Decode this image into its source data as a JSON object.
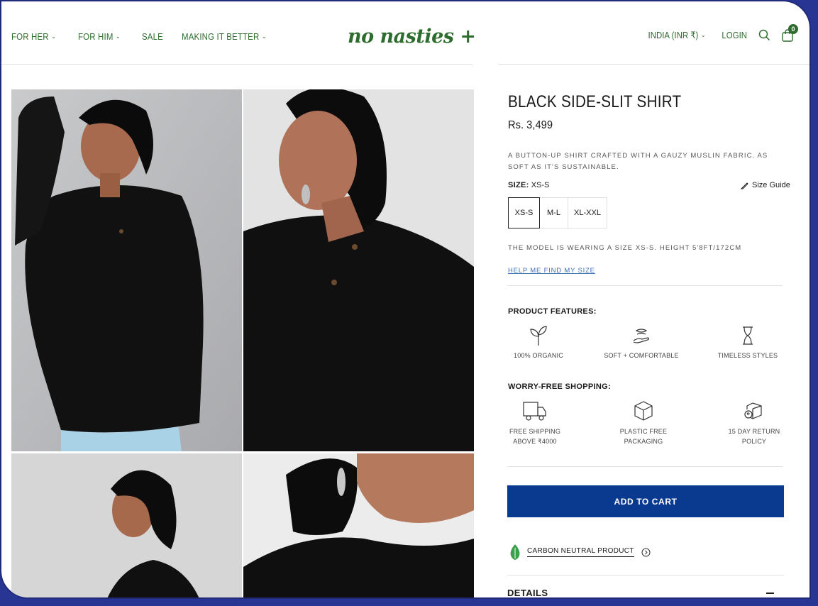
{
  "nav": {
    "items": [
      {
        "label": "FOR HER",
        "has_dropdown": true
      },
      {
        "label": "FOR HIM",
        "has_dropdown": true
      },
      {
        "label": "SALE",
        "has_dropdown": false
      },
      {
        "label": "MAKING IT BETTER",
        "has_dropdown": true
      }
    ],
    "chevron": "⌄"
  },
  "brand": {
    "logo_text": "no nasties +",
    "color": "#2e6b2e"
  },
  "header_right": {
    "currency": "INDIA (INR ₹)",
    "login": "LOGIN",
    "cart_count": "0"
  },
  "gallery": {
    "images": [
      {
        "alt": "model in black shirt, hand behind head"
      },
      {
        "alt": "close-up of model in black shirt"
      },
      {
        "alt": "model side profile"
      },
      {
        "alt": "close-up of collar and earring"
      }
    ]
  },
  "product": {
    "title": "BLACK SIDE-SLIT SHIRT",
    "price": "Rs. 3,499",
    "description": "A BUTTON-UP SHIRT CRAFTED WITH A GAUZY MUSLIN FABRIC. AS SOFT AS IT'S SUSTAINABLE.",
    "size_label": "SIZE:",
    "selected_size": "XS-S",
    "size_guide": "Size Guide",
    "sizes": [
      "XS-S",
      "M-L",
      "XL-XXL"
    ],
    "model_note": "THE MODEL IS WEARING A SIZE XS-S. HEIGHT 5'8FT/172CM",
    "help_link": "HELP ME FIND MY SIZE"
  },
  "features": {
    "title": "PRODUCT FEATURES:",
    "items": [
      {
        "icon": "sprout-icon",
        "label": "100% ORGANIC"
      },
      {
        "icon": "hand-fabric-icon",
        "label": "SOFT + COMFORTABLE"
      },
      {
        "icon": "hourglass-icon",
        "label": "TIMELESS STYLES"
      }
    ]
  },
  "shopping": {
    "title": "WORRY-FREE SHOPPING:",
    "items": [
      {
        "icon": "truck-icon",
        "line1": "FREE SHIPPING",
        "line2": "ABOVE ₹4000"
      },
      {
        "icon": "box-icon",
        "line1": "PLASTIC FREE",
        "line2": "PACKAGING"
      },
      {
        "icon": "return-box-icon",
        "line1": "15 DAY RETURN",
        "line2": "POLICY"
      }
    ]
  },
  "cart": {
    "label": "ADD TO CART",
    "color": "#0a3a8f"
  },
  "carbon": {
    "label": "CARBON NEUTRAL PRODUCT"
  },
  "details": {
    "label": "DETAILS"
  }
}
